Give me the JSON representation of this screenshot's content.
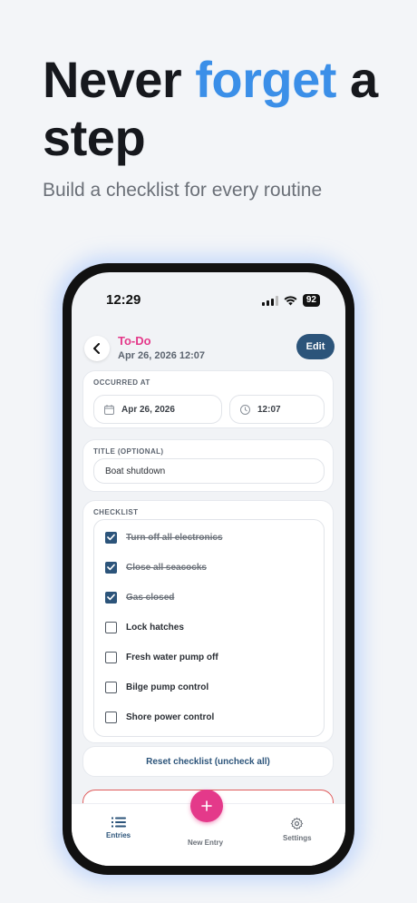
{
  "headline": {
    "part1": "Never ",
    "accent": "forget",
    "part2": " a step"
  },
  "subtitle": "Build a checklist for every routine",
  "status_bar": {
    "time": "12:29",
    "battery": "92"
  },
  "header": {
    "title": "To-Do",
    "date": "Apr 26, 2026 12:07",
    "edit_label": "Edit"
  },
  "occurred": {
    "label": "OCCURRED AT",
    "date": "Apr 26, 2026",
    "time": "12:07"
  },
  "title_field": {
    "label": "TITLE (OPTIONAL)",
    "value": "Boat shutdown"
  },
  "checklist": {
    "label": "CHECKLIST",
    "items": [
      {
        "label": "Turn off all electronics",
        "checked": true
      },
      {
        "label": "Close all seacocks",
        "checked": true
      },
      {
        "label": "Gas closed",
        "checked": true
      },
      {
        "label": "Lock hatches",
        "checked": false
      },
      {
        "label": "Fresh water pump off",
        "checked": false
      },
      {
        "label": "Bilge pump control",
        "checked": false
      },
      {
        "label": "Shore power control",
        "checked": false
      }
    ]
  },
  "reset_label": "Reset checklist (uncheck all)",
  "tabs": {
    "entries": "Entries",
    "new_entry": "New Entry",
    "settings": "Settings"
  },
  "colors": {
    "accent_blue": "#3b8fe8",
    "brand_pink": "#e4398a",
    "primary_navy": "#2c547a"
  }
}
